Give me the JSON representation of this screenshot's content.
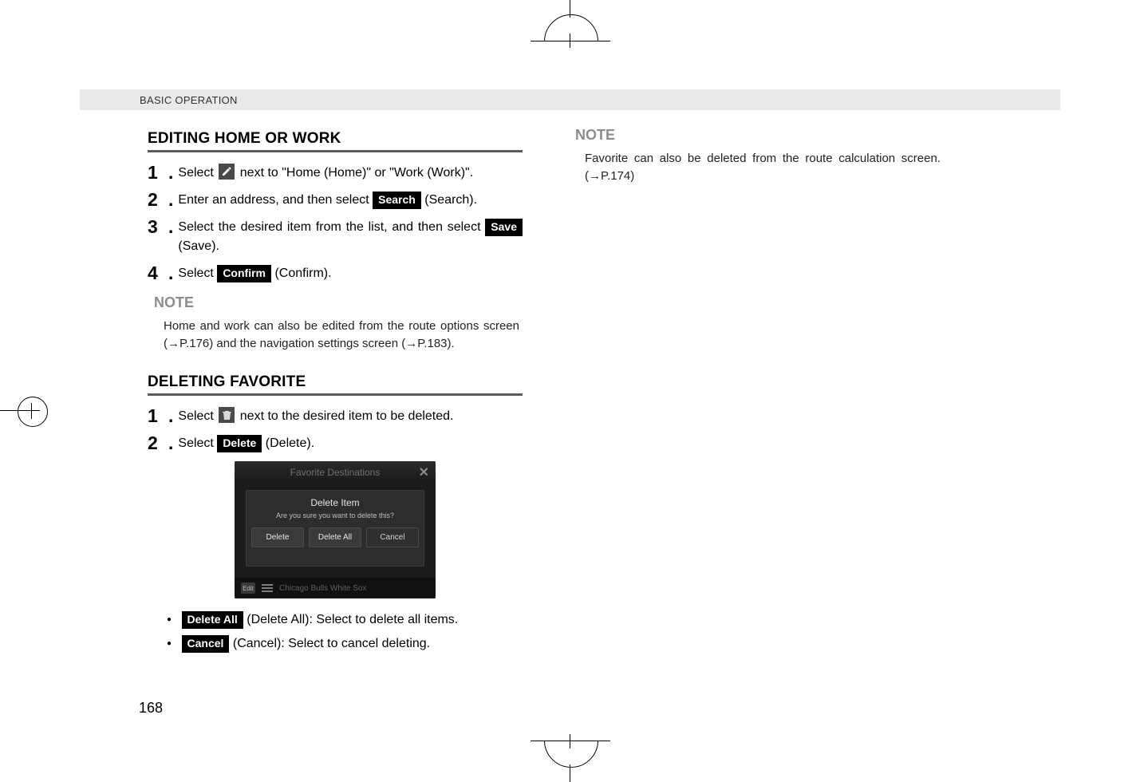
{
  "header": {
    "section": "BASIC OPERATION"
  },
  "page_number": "168",
  "left": {
    "section1": {
      "title": "EDITING HOME OR WORK",
      "steps": {
        "s1": {
          "num": "1",
          "pre": "Select ",
          "post": " next to \"Home (Home)\" or \"Work (Work)\"."
        },
        "s2": {
          "num": "2",
          "pre": "Enter an address, and then select ",
          "btn": "Search",
          "post": " (Search)."
        },
        "s3": {
          "num": "3",
          "pre": "Select the desired item from the list, and then select ",
          "btn": "Save",
          "post": " (Save)."
        },
        "s4": {
          "num": "4",
          "pre": "Select ",
          "btn": "Confirm",
          "post": " (Confirm)."
        }
      },
      "note": {
        "head": "NOTE",
        "body": "Home and work can also be edited from the route options screen (→P.176) and the navigation settings screen (→P.183)."
      }
    },
    "section2": {
      "title": "DELETING FAVORITE",
      "steps": {
        "s1": {
          "num": "1",
          "pre": "Select ",
          "post": " next to the desired item to be deleted."
        },
        "s2": {
          "num": "2",
          "pre": "Select ",
          "btn": "Delete",
          "post": " (Delete)."
        }
      },
      "shot": {
        "title": "Favorite Destinations",
        "dialog_title": "Delete Item",
        "dialog_msg": "Are you sure you want to delete this?",
        "btn_delete": "Delete",
        "btn_delete_all": "Delete All",
        "btn_cancel": "Cancel",
        "bottom_text": "Chicago Bulls White Sox",
        "pencil_label": "Edit"
      },
      "bullets": {
        "b1": {
          "btn": "Delete All",
          "text": " (Delete All): Select to delete all items."
        },
        "b2": {
          "btn": "Cancel",
          "text": " (Cancel): Select to cancel deleting."
        }
      }
    }
  },
  "right": {
    "note": {
      "head": "NOTE",
      "body": "Favorite can also be deleted from the route calculation screen. (→P.174)"
    }
  }
}
